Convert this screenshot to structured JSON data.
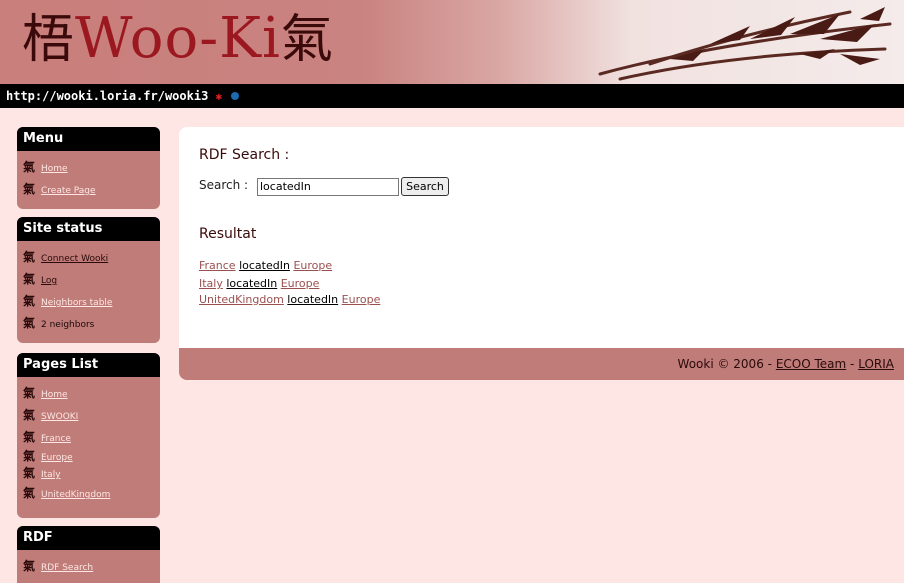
{
  "header": {
    "logo_left": "梧",
    "logo_text": "Woo-Ki",
    "logo_right": "氣",
    "url": "http://wooki.loria.fr/wooki3"
  },
  "menu": {
    "title": "Menu",
    "items": [
      {
        "label": "Home"
      },
      {
        "label": "Create Page"
      }
    ]
  },
  "site_status": {
    "title": "Site status",
    "items": [
      {
        "label": "Connect Wooki"
      },
      {
        "label": "Log"
      },
      {
        "label": "Neighbors table"
      },
      {
        "label": "2 neighbors"
      }
    ]
  },
  "pages_list": {
    "title": "Pages List",
    "items": [
      {
        "label": "Home"
      },
      {
        "label": "SWOOKI"
      },
      {
        "label": "France"
      },
      {
        "label": "Europe"
      },
      {
        "label": "Italy"
      },
      {
        "label": "UnitedKingdom"
      }
    ]
  },
  "rdf": {
    "title": "RDF",
    "items": [
      {
        "label": "RDF Search"
      }
    ]
  },
  "main": {
    "heading": "RDF Search :",
    "search_label": "Search :",
    "search_value": "locatedIn",
    "search_button": "Search",
    "results_heading": "Resultat",
    "results": [
      {
        "subject": "France",
        "predicate": "locatedIn",
        "object": "Europe"
      },
      {
        "subject": "Italy",
        "predicate": "locatedIn",
        "object": "Europe"
      },
      {
        "subject": "UnitedKingdom",
        "predicate": "locatedIn",
        "object": "Europe"
      }
    ]
  },
  "footer": {
    "text": "Wooki © 2006 -",
    "link1": "ECOO Team",
    "sep": "-",
    "link2": "LORIA"
  },
  "colors": {
    "accent": "#c07c78",
    "background": "#fde6e3",
    "title_bar": "#000000"
  }
}
